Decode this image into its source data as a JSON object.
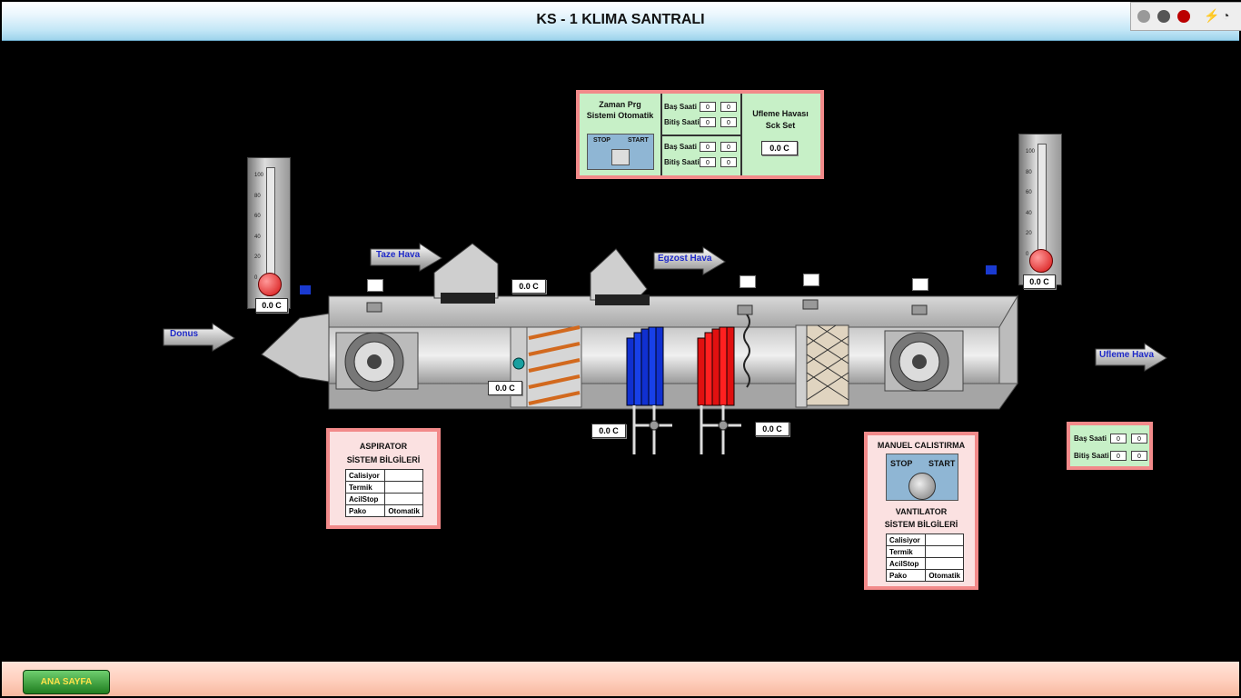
{
  "window": {
    "title": "KS - 1 KLIMA SANTRALI"
  },
  "footer": {
    "home_label": "ANA SAYFA"
  },
  "flow_labels": {
    "donus": "Donus",
    "taze": "Taze Hava",
    "egzost": "Egzost Hava",
    "ufleme": "Ufleme Hava"
  },
  "thermometers": {
    "left": {
      "ticks": [
        "100",
        "80",
        "60",
        "40",
        "20",
        "0"
      ],
      "value": "0.0 C",
      "level": 0.0
    },
    "right": {
      "ticks": [
        "100",
        "80",
        "60",
        "40",
        "20",
        "0"
      ],
      "value": "0.0 C",
      "level": 0.0
    }
  },
  "readings": {
    "taze_temp": "0.0 C",
    "mix_temp": "0.0 C",
    "cool_valve_temp": "0.0 C",
    "heat_valve_temp": "0.0 C"
  },
  "schedule_panel": {
    "mode_label": "Zaman Prg Sistemi Otomatik",
    "stop": "STOP",
    "start": "START",
    "rows": [
      {
        "label": "Baş Saati",
        "h": "0",
        "m": "0"
      },
      {
        "label": "Bitiş Saati",
        "h": "0",
        "m": "0"
      },
      {
        "label": "Baş Saati",
        "h": "0",
        "m": "0"
      },
      {
        "label": "Bitiş Saati",
        "h": "0",
        "m": "0"
      }
    ],
    "setpoint_label": "Ufleme Havası Sck Set",
    "setpoint_value": "0.0 C"
  },
  "right_schedule": {
    "rows": [
      {
        "label": "Baş Saati",
        "h": "0",
        "m": "0"
      },
      {
        "label": "Bitiş Saati",
        "h": "0",
        "m": "0"
      }
    ]
  },
  "aspirator": {
    "title": "ASPIRATOR",
    "subtitle": "SİSTEM BİLGİLERİ",
    "rows": [
      {
        "label": "Calisiyor",
        "value": ""
      },
      {
        "label": "Termik",
        "value": ""
      },
      {
        "label": "AcilStop",
        "value": ""
      },
      {
        "label": "Pako",
        "value": "Otomatik"
      }
    ]
  },
  "vantilator": {
    "manual_title": "MANUEL CALISTIRMA",
    "stop": "STOP",
    "start": "START",
    "title": "VANTILATOR",
    "subtitle": "SİSTEM BİLGİLERİ",
    "rows": [
      {
        "label": "Calisiyor",
        "value": ""
      },
      {
        "label": "Termik",
        "value": ""
      },
      {
        "label": "AcilStop",
        "value": ""
      },
      {
        "label": "Pako",
        "value": "Otomatik"
      }
    ]
  },
  "colors": {
    "panel_green": "#c7f0c7",
    "panel_border": "#f28a8a",
    "cooling_coil": "#1030d0",
    "heating_coil": "#e01010"
  }
}
